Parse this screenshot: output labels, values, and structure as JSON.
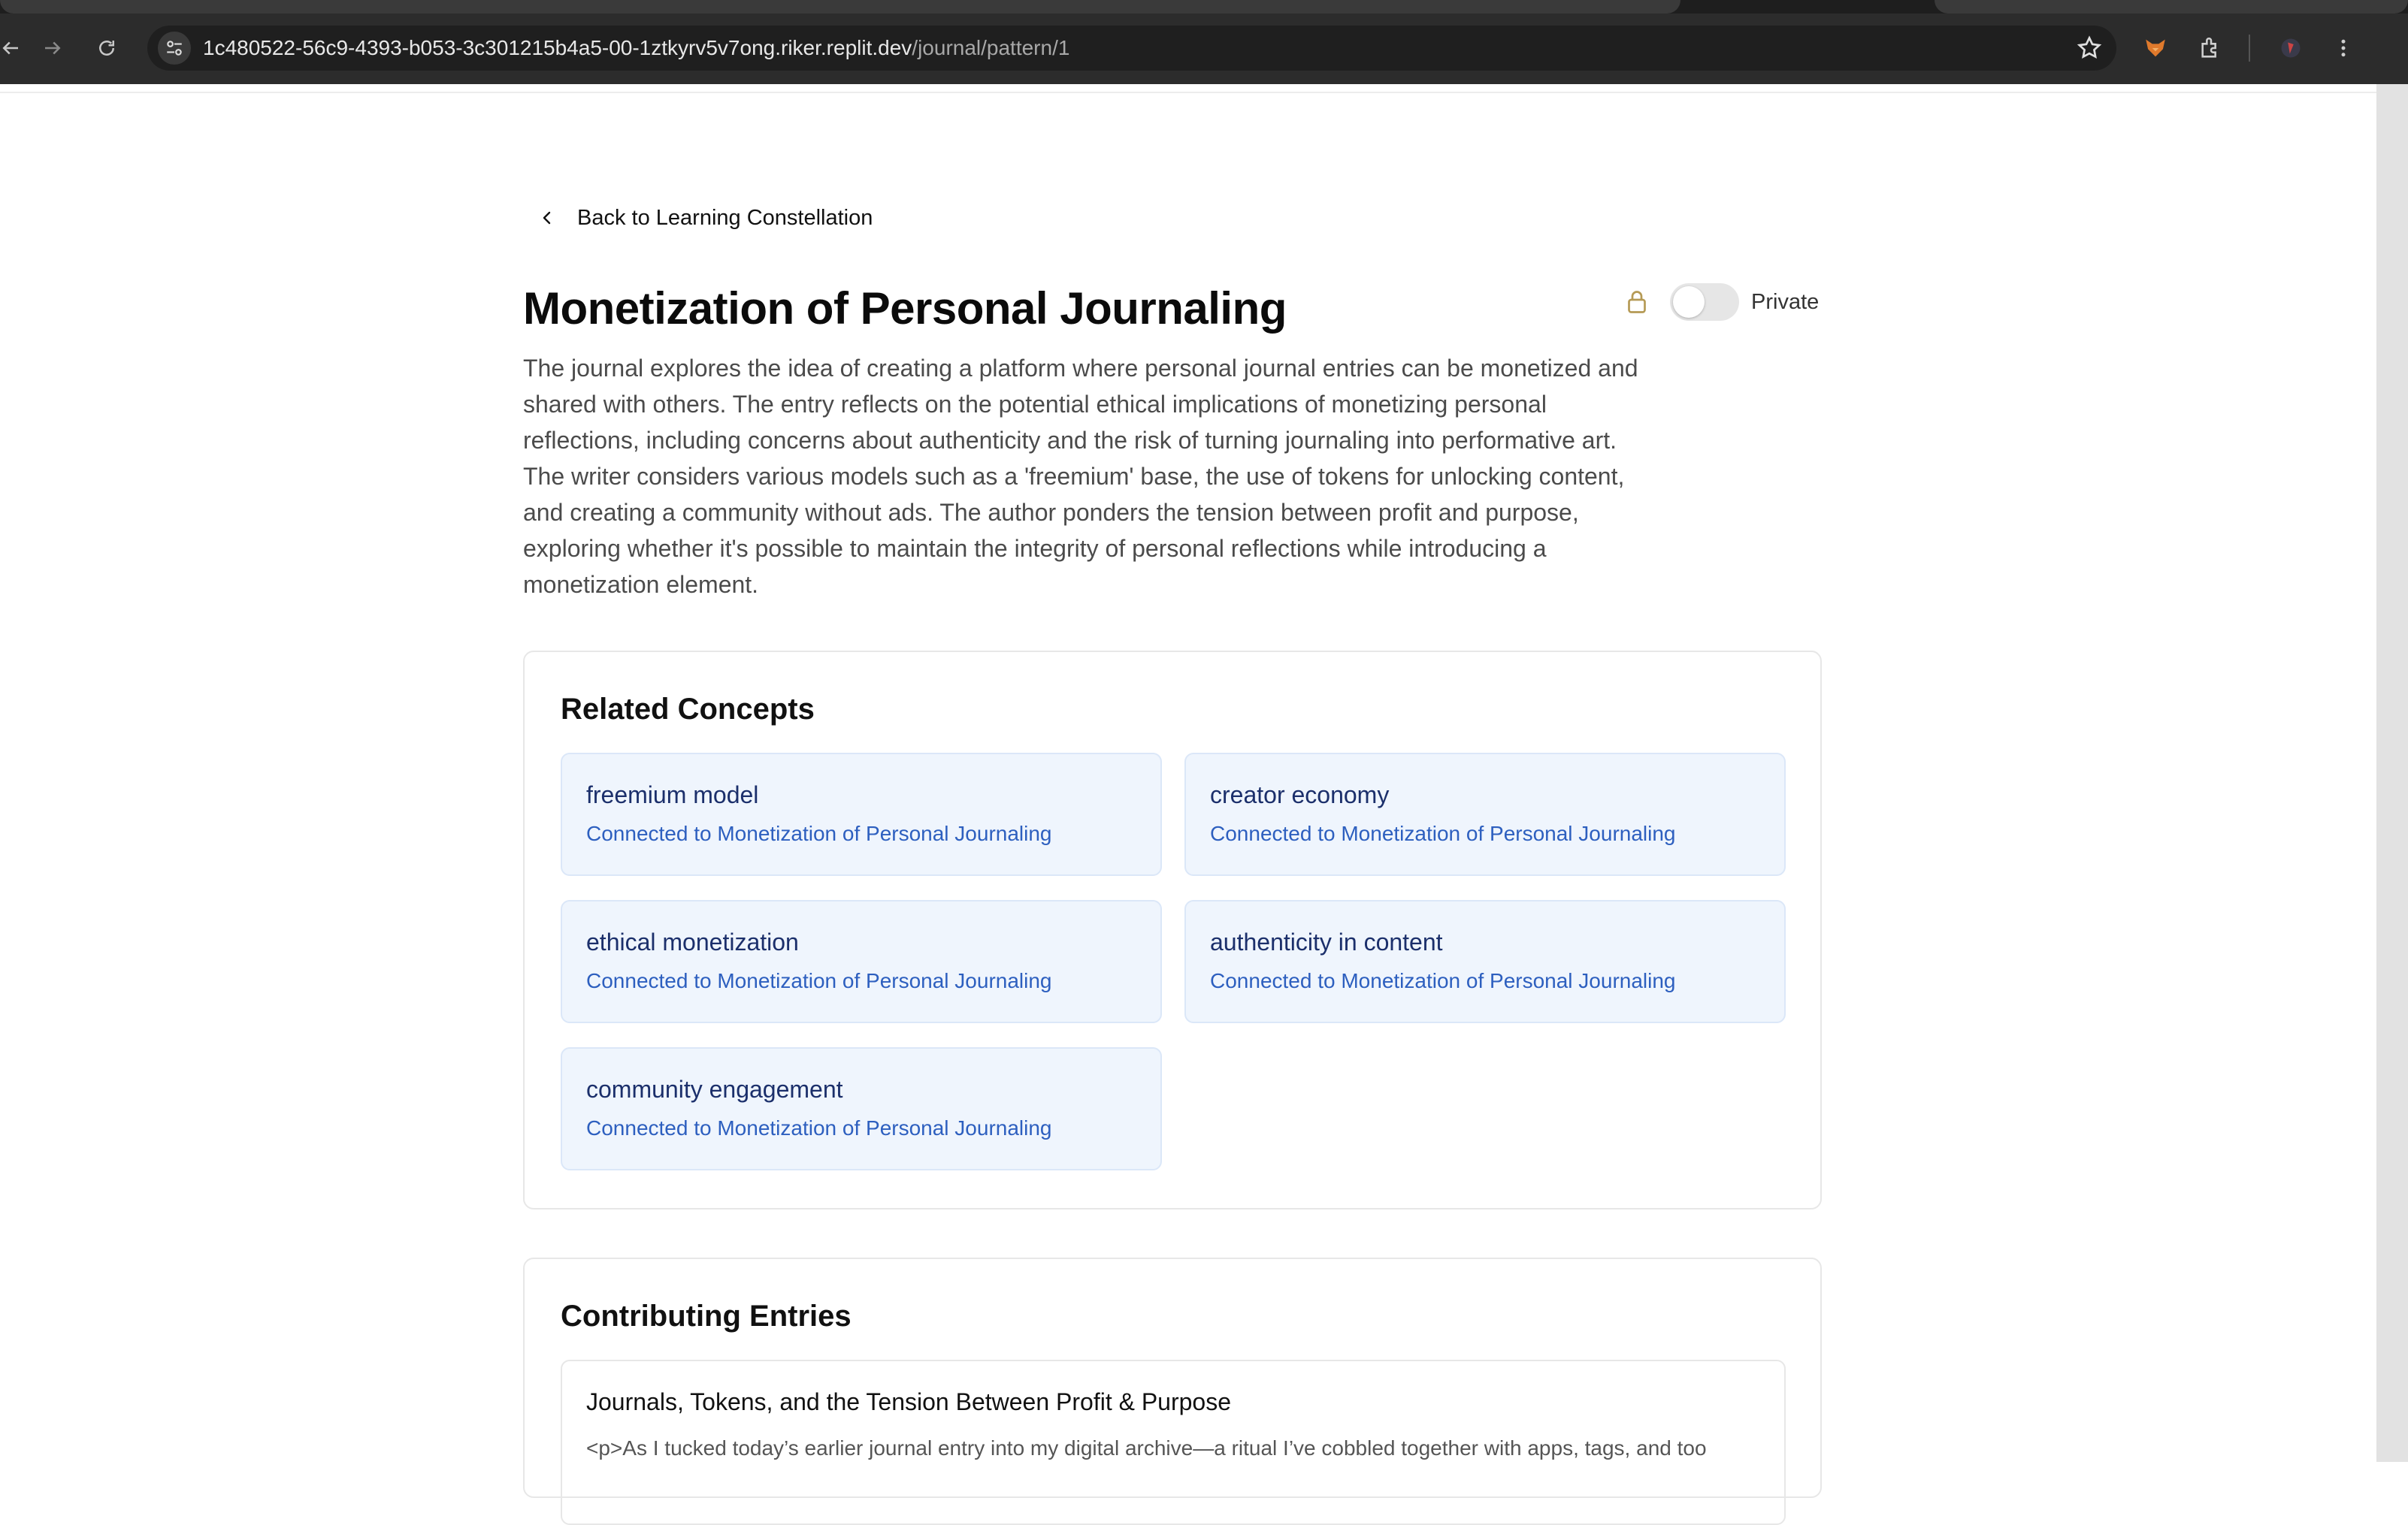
{
  "browser": {
    "url_host": "1c480522-56c9-4393-b053-3c301215b4a5-00-1ztkyrv5v7ong.riker.replit.dev",
    "url_path": "/journal/pattern/1",
    "icons": [
      "back-arrow-icon",
      "forward-arrow-icon",
      "reload-icon",
      "site-info-icon",
      "star-icon",
      "fox-extension-icon",
      "puzzle-extension-icon",
      "profile-avatar-icon",
      "menu-dots-icon"
    ]
  },
  "page": {
    "back_label": "Back to Learning Constellation",
    "title": "Monetization of Personal Journaling",
    "privacy_label": "Private",
    "privacy_on": false,
    "summary": "The journal explores the idea of creating a platform where personal journal entries can be monetized and shared with others. The entry reflects on the potential ethical implications of monetizing personal reflections, including concerns about authenticity and the risk of turning journaling into performative art. The writer considers various models such as a 'freemium' base, the use of tokens for unlocking content, and creating a community without ads. The author ponders the tension between profit and purpose, exploring whether it's possible to maintain the integrity of personal reflections while introducing a monetization element."
  },
  "related": {
    "heading": "Related Concepts",
    "items": [
      {
        "name": "freemium model",
        "sub": "Connected to Monetization of Personal Journaling"
      },
      {
        "name": "creator economy",
        "sub": "Connected to Monetization of Personal Journaling"
      },
      {
        "name": "ethical monetization",
        "sub": "Connected to Monetization of Personal Journaling"
      },
      {
        "name": "authenticity in content",
        "sub": "Connected to Monetization of Personal Journaling"
      },
      {
        "name": "community engagement",
        "sub": "Connected to Monetization of Personal Journaling"
      }
    ]
  },
  "entries": {
    "heading": "Contributing Entries",
    "items": [
      {
        "title": "Journals, Tokens, and the Tension Between Profit & Purpose",
        "excerpt": "<p>As I tucked today’s earlier journal entry into my digital archive—a ritual I’ve cobbled together with apps, tags, and too"
      }
    ]
  },
  "colors": {
    "accent": "#2d5fbf",
    "concept_bg": "#eff5fd",
    "lock": "#b59a55"
  }
}
